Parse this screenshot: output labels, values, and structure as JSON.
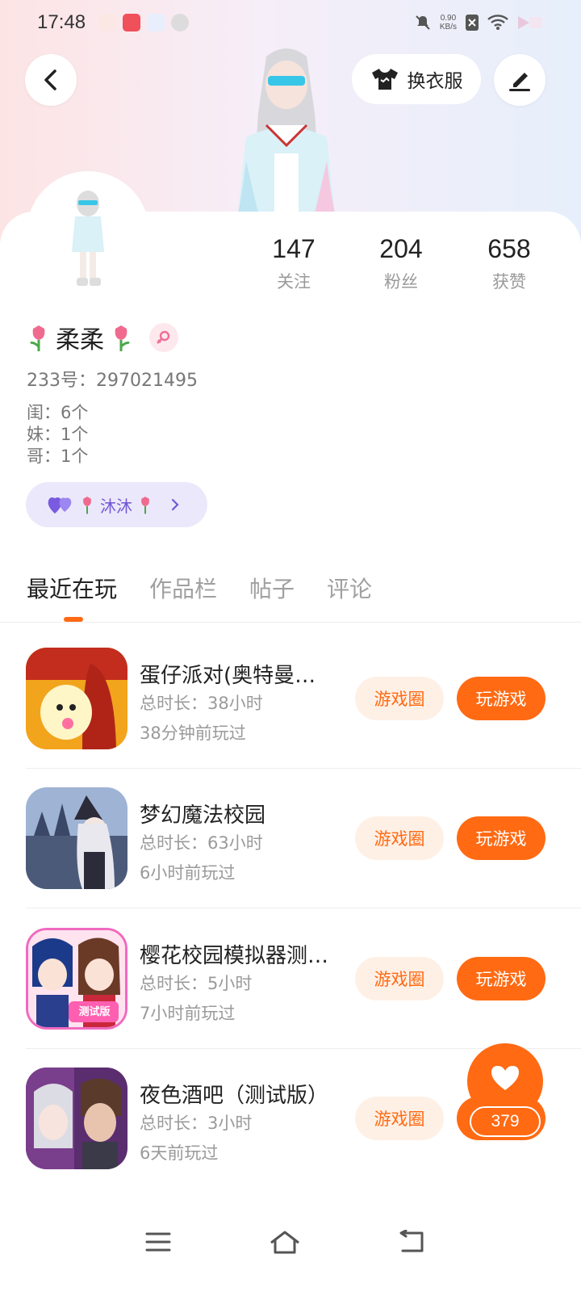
{
  "status_bar": {
    "time": "17:48",
    "net_speed_value": "0.90",
    "net_speed_unit": "KB/s"
  },
  "header": {
    "outfit_label": "换衣服"
  },
  "stats": {
    "following": {
      "value": "147",
      "label": "关注"
    },
    "fans": {
      "value": "204",
      "label": "粉丝"
    },
    "likes": {
      "value": "658",
      "label": "获赞"
    }
  },
  "profile": {
    "name": "柔柔",
    "id_text": "233号：297021495",
    "relations": [
      "闺：6个",
      "妹：1个",
      "哥：1个"
    ],
    "cp_name": "沐沐"
  },
  "tabs": [
    {
      "label": "最近在玩"
    },
    {
      "label": "作品栏"
    },
    {
      "label": "帖子"
    },
    {
      "label": "评论"
    }
  ],
  "games": [
    {
      "title": "蛋仔派对(奥特曼…",
      "duration": "总时长：38小时",
      "last_played": "38分钟前玩过",
      "circle_label": "游戏圈",
      "play_label": "玩游戏",
      "icon": "egg-party-icon"
    },
    {
      "title": "梦幻魔法校园",
      "duration": "总时长：63小时",
      "last_played": "6小时前玩过",
      "circle_label": "游戏圈",
      "play_label": "玩游戏",
      "icon": "magic-school-icon"
    },
    {
      "title": "樱花校园模拟器测…",
      "duration": "总时长：5小时",
      "last_played": "7小时前玩过",
      "circle_label": "游戏圈",
      "play_label": "玩游戏",
      "icon": "sakura-school-icon",
      "icon_badge": "测试版"
    },
    {
      "title": "夜色酒吧（测试版）",
      "duration": "总时长：3小时",
      "last_played": "6天前玩过",
      "circle_label": "游戏圈",
      "play_label": "玩游戏",
      "icon": "night-bar-icon"
    }
  ],
  "like_fab": {
    "count": "379"
  },
  "colors": {
    "accent": "#ff6a13",
    "accent_light": "#fff0e6",
    "cp_bg": "#ece8fb",
    "cp_text": "#7157d8"
  }
}
